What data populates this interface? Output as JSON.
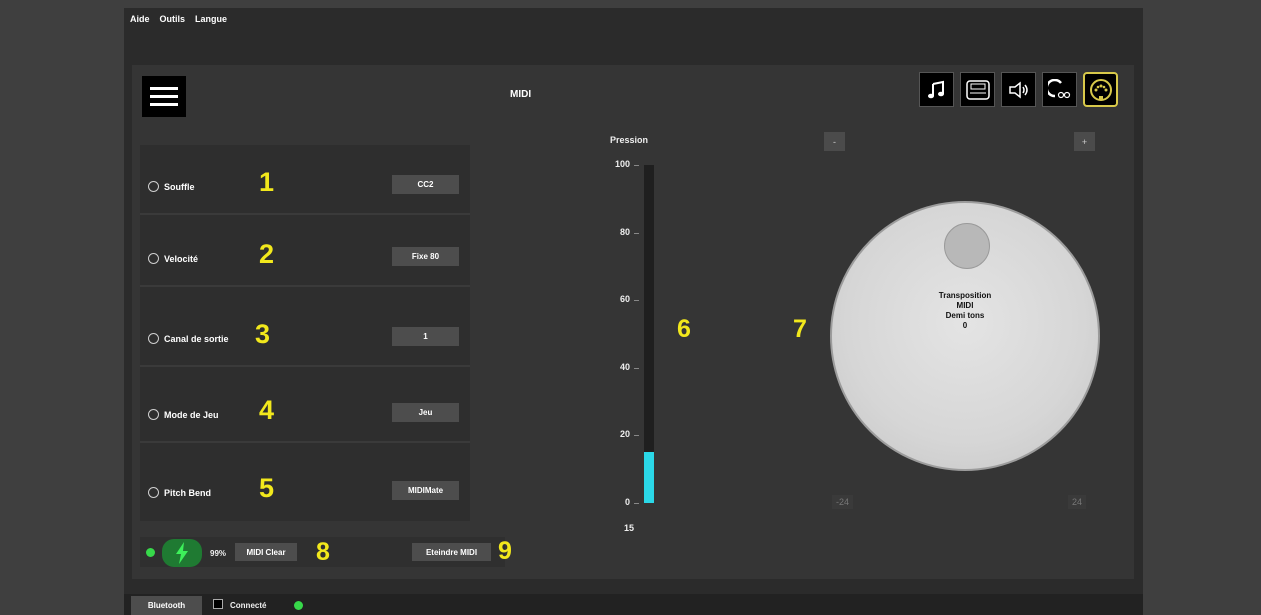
{
  "menubar": {
    "items": [
      "Aide",
      "Outils",
      "Langue"
    ]
  },
  "header": {
    "title": "MIDI"
  },
  "toolbar": {
    "icons": [
      "music-note-icon",
      "keyboard-display-icon",
      "speaker-icon",
      "loop-icon",
      "midi-connector-icon"
    ]
  },
  "settings": {
    "rows": [
      {
        "label": "Souffle",
        "number": "1",
        "value": "CC2"
      },
      {
        "label": "Velocité",
        "number": "2",
        "value": "Fixe 80"
      },
      {
        "label": "Canal de sortie",
        "number": "3",
        "value": "1"
      },
      {
        "label": "Mode de Jeu",
        "number": "4",
        "value": "Jeu"
      },
      {
        "label": "Pitch Bend",
        "number": "5",
        "value": "MIDIMate"
      }
    ]
  },
  "status": {
    "battery_percent": "99%",
    "midi_clear_label": "MIDI Clear",
    "midi_clear_number": "8",
    "midi_off_label": "Eteindre MIDI",
    "midi_off_number": "9",
    "indicator_color": "#37d84a"
  },
  "pressure": {
    "label": "Pression",
    "ticks": [
      "100",
      "80",
      "60",
      "40",
      "20",
      "0"
    ],
    "value": "15",
    "level": 15,
    "max": 100,
    "number": "6",
    "fill_color": "#2bd8e8"
  },
  "transposition": {
    "number": "7",
    "decrement_label": "-",
    "increment_label": "+",
    "lines": [
      "Transposition",
      "MIDI",
      "Demi tons",
      "0"
    ],
    "min": "-24",
    "max": "24"
  },
  "footer": {
    "bluetooth_label": "Bluetooth",
    "connected_label": "Connecté"
  }
}
